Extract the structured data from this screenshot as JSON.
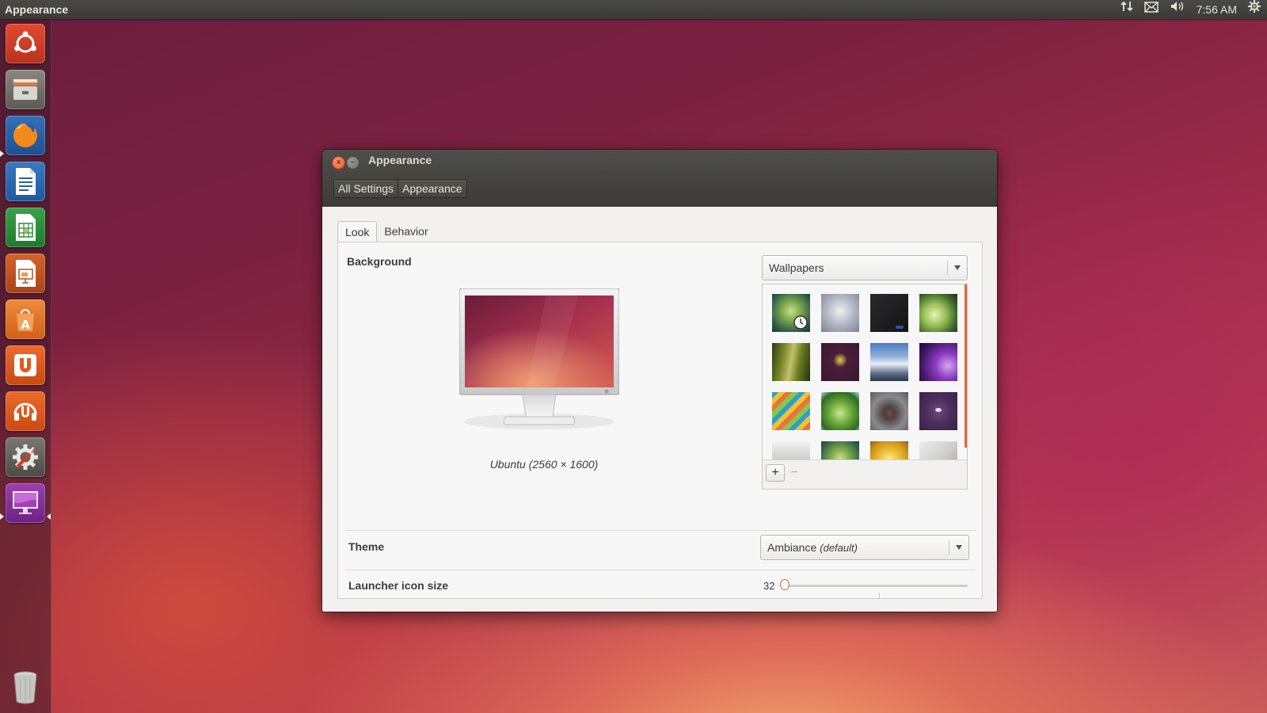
{
  "top_panel": {
    "app_title": "Appearance",
    "clock": "7:56 AM"
  },
  "launcher": {
    "items": [
      "ubuntu-dash",
      "files",
      "firefox",
      "libreoffice-writer",
      "libreoffice-calc",
      "libreoffice-impress",
      "ubuntu-software-center",
      "ubuntu-one",
      "ubuntu-one-music",
      "system-settings",
      "appearance",
      "trash"
    ]
  },
  "window": {
    "title": "Appearance",
    "breadcrumbs": [
      "All Settings",
      "Appearance"
    ],
    "tabs": [
      "Look",
      "Behavior"
    ],
    "active_tab": "Look",
    "background": {
      "label": "Background",
      "caption": "Ubuntu (2560 × 1600)",
      "source_combo": "Wallpapers",
      "add_label": "+",
      "remove_label": "−"
    },
    "theme": {
      "label": "Theme",
      "value": "Ambiance",
      "suffix": "(default)"
    },
    "launcher_icon_size": {
      "label": "Launcher icon size",
      "value": "32"
    }
  },
  "colors": {
    "accent": "#e0673a",
    "panel_dark": "#3c3b37"
  }
}
